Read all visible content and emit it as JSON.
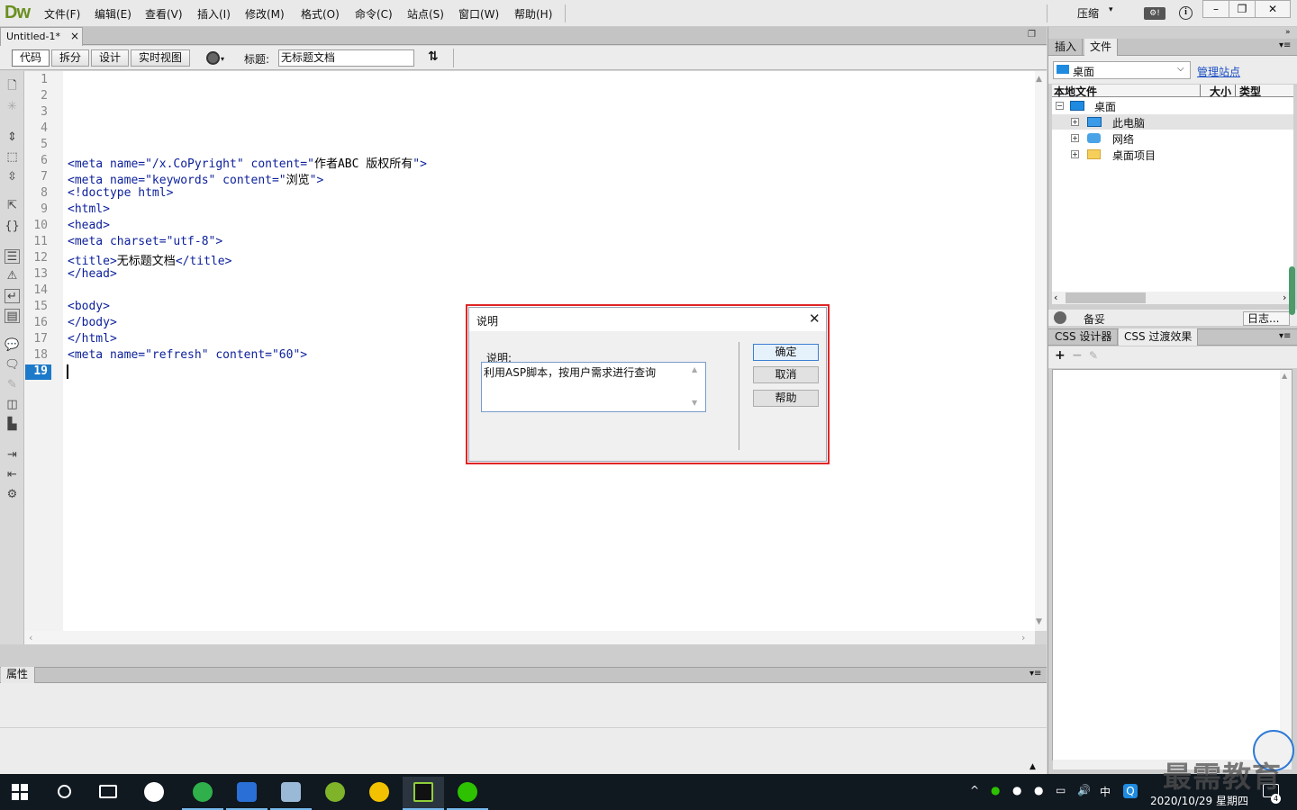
{
  "app": {
    "logo": "Dw",
    "menu": [
      "文件(F)",
      "编辑(E)",
      "查看(V)",
      "插入(I)",
      "修改(M)",
      "格式(O)",
      "命令(C)",
      "站点(S)",
      "窗口(W)",
      "帮助(H)"
    ],
    "compress_label": "压缩",
    "window_controls": {
      "minimize": "–",
      "maximize": "❐",
      "close": "✕"
    }
  },
  "document": {
    "tab_label": "Untitled-1*",
    "tab_close": "×",
    "view_buttons": {
      "code": "代码",
      "split": "拆分",
      "design": "设计",
      "live": "实时视图"
    },
    "title_label": "标题:",
    "title_value": "无标题文档"
  },
  "editor": {
    "line_numbers": [
      "1",
      "2",
      "3",
      "4",
      "5",
      "6",
      "7",
      "8",
      "9",
      "10",
      "11",
      "12",
      "13",
      "14",
      "15",
      "16",
      "17",
      "18",
      "19"
    ],
    "current_line": "19",
    "lines": {
      "l6": {
        "a": "<meta name=\"/x.CoPyright\" content=\"",
        "b": "作者ABC 版权所有",
        "c": "\">"
      },
      "l7": {
        "a": "<meta name=\"keywords\" content=\"",
        "b": "浏览",
        "c": "\">"
      },
      "l8": "<!doctype html>",
      "l9": "<html>",
      "l10": "<head>",
      "l11": "<meta charset=\"utf-8\">",
      "l12": {
        "a": "<title>",
        "b": "无标题文档",
        "c": "</title>"
      },
      "l13": "</head>",
      "l15": "<body>",
      "l16": "</body>",
      "l17": "</html>",
      "l18": "<meta name=\"refresh\" content=\"60\">"
    }
  },
  "properties": {
    "label": "属性"
  },
  "files_panel": {
    "tabs": {
      "insert": "插入",
      "files": "文件"
    },
    "site_select": "桌面",
    "manage_site": "管理站点",
    "columns": {
      "local": "本地文件",
      "size": "大小",
      "type": "类型"
    },
    "tree": {
      "root": "桌面",
      "items": [
        {
          "label": "此电脑",
          "icon": "computer-icon"
        },
        {
          "label": "网络",
          "icon": "network-icon"
        },
        {
          "label": "桌面项目",
          "icon": "folder-icon"
        }
      ]
    },
    "status": "备妥",
    "log_button": "日志..."
  },
  "css_panel": {
    "tabs": {
      "designer": "CSS 设计器",
      "transitions": "CSS 过渡效果"
    },
    "add": "+",
    "remove": "−",
    "edit": "✎"
  },
  "dialog": {
    "title": "说明",
    "close": "✕",
    "field_label": "说明:",
    "text_value": "利用ASP脚本，按用户需求进行查询",
    "buttons": {
      "ok": "确定",
      "cancel": "取消",
      "help": "帮助"
    }
  },
  "taskbar": {
    "tray_text": {
      "ime": "中"
    },
    "date": "2020/10/29 星期四",
    "notification_count": "4"
  },
  "watermark": {
    "text": "最需教育"
  },
  "colors": {
    "accent_blue": "#1d79c9",
    "highlight_red": "#e02525",
    "code_tag": "#0b1f9a",
    "dw_green": "#6a8f20"
  }
}
